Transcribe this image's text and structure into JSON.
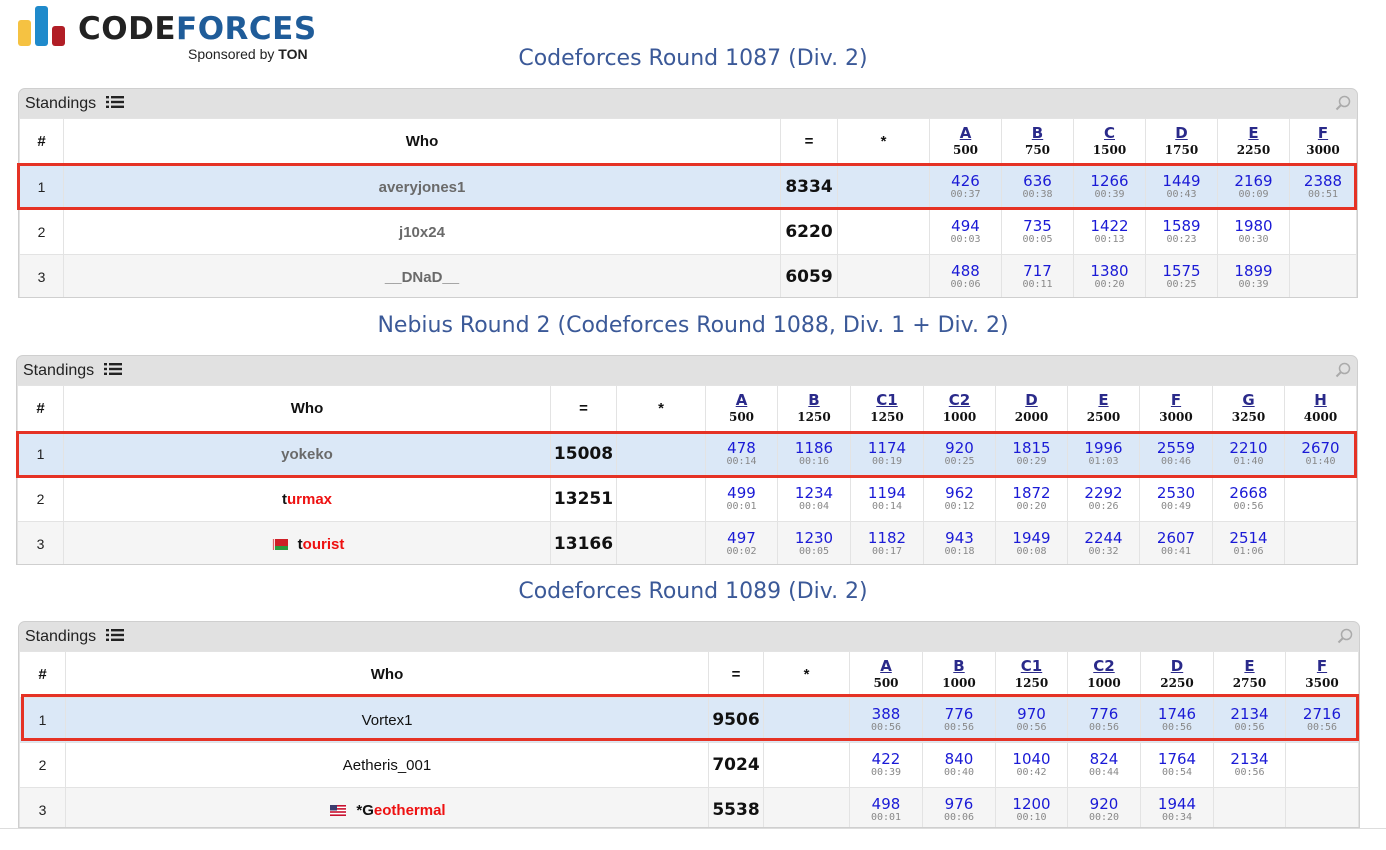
{
  "logo": {
    "text_1": "CODE",
    "text_2": "FORCES",
    "sponsor": "Sponsored by ",
    "sponsor_brand": "TON"
  },
  "colors": {
    "highlight_border": "#e53225",
    "highlight_row": "#dbe8f7",
    "title": "#3b5998",
    "result": "#1a1ad6",
    "red_handle": "#ee1111"
  },
  "icons": {
    "list": "list-icon",
    "search": "search-icon"
  },
  "contests": [
    {
      "title": "Codeforces Round 1087 (Div. 2)",
      "box_label": "Standings",
      "headers": {
        "rank": "#",
        "who": "Who",
        "points": "=",
        "penalty": "*"
      },
      "problems": [
        {
          "letter": "A",
          "points": "500"
        },
        {
          "letter": "B",
          "points": "750"
        },
        {
          "letter": "C",
          "points": "1500"
        },
        {
          "letter": "D",
          "points": "1750"
        },
        {
          "letter": "E",
          "points": "2250"
        },
        {
          "letter": "F",
          "points": "3000"
        }
      ],
      "rows": [
        {
          "rank": "1",
          "handle": "averyjones1",
          "points": "8334",
          "penalty": "",
          "results": [
            {
              "p": "426",
              "t": "00:37"
            },
            {
              "p": "636",
              "t": "00:38"
            },
            {
              "p": "1266",
              "t": "00:39"
            },
            {
              "p": "1449",
              "t": "00:43"
            },
            {
              "p": "2169",
              "t": "00:09"
            },
            {
              "p": "2388",
              "t": "00:51"
            }
          ]
        },
        {
          "rank": "2",
          "handle": "j10x24",
          "points": "6220",
          "penalty": "",
          "results": [
            {
              "p": "494",
              "t": "00:03"
            },
            {
              "p": "735",
              "t": "00:05"
            },
            {
              "p": "1422",
              "t": "00:13"
            },
            {
              "p": "1589",
              "t": "00:23"
            },
            {
              "p": "1980",
              "t": "00:30"
            },
            {
              "p": "",
              "t": ""
            }
          ]
        },
        {
          "rank": "3",
          "handle": "__DNaD__",
          "points": "6059",
          "penalty": "",
          "results": [
            {
              "p": "488",
              "t": "00:06"
            },
            {
              "p": "717",
              "t": "00:11"
            },
            {
              "p": "1380",
              "t": "00:20"
            },
            {
              "p": "1575",
              "t": "00:25"
            },
            {
              "p": "1899",
              "t": "00:39"
            },
            {
              "p": "",
              "t": ""
            }
          ]
        }
      ]
    },
    {
      "title": "Nebius Round 2 (Codeforces Round 1088, Div. 1 + Div. 2)",
      "box_label": "Standings",
      "headers": {
        "rank": "#",
        "who": "Who",
        "points": "=",
        "penalty": "*"
      },
      "problems": [
        {
          "letter": "A",
          "points": "500"
        },
        {
          "letter": "B",
          "points": "1250"
        },
        {
          "letter": "C1",
          "points": "1250"
        },
        {
          "letter": "C2",
          "points": "1000"
        },
        {
          "letter": "D",
          "points": "2000"
        },
        {
          "letter": "E",
          "points": "2500"
        },
        {
          "letter": "F",
          "points": "3000"
        },
        {
          "letter": "G",
          "points": "3250"
        },
        {
          "letter": "H",
          "points": "4000"
        }
      ],
      "rows": [
        {
          "rank": "1",
          "handle": "yokeko",
          "points": "15008",
          "penalty": "",
          "results": [
            {
              "p": "478",
              "t": "00:14"
            },
            {
              "p": "1186",
              "t": "00:16"
            },
            {
              "p": "1174",
              "t": "00:19"
            },
            {
              "p": "920",
              "t": "00:25"
            },
            {
              "p": "1815",
              "t": "00:29"
            },
            {
              "p": "1996",
              "t": "01:03"
            },
            {
              "p": "2559",
              "t": "00:46"
            },
            {
              "p": "2210",
              "t": "01:40"
            },
            {
              "p": "2670",
              "t": "01:40"
            }
          ]
        },
        {
          "rank": "2",
          "handle_first": "t",
          "handle_rest": "urmax",
          "points": "13251",
          "penalty": "",
          "results": [
            {
              "p": "499",
              "t": "00:01"
            },
            {
              "p": "1234",
              "t": "00:04"
            },
            {
              "p": "1194",
              "t": "00:14"
            },
            {
              "p": "962",
              "t": "00:12"
            },
            {
              "p": "1872",
              "t": "00:20"
            },
            {
              "p": "2292",
              "t": "00:26"
            },
            {
              "p": "2530",
              "t": "00:49"
            },
            {
              "p": "2668",
              "t": "00:56"
            },
            {
              "p": "",
              "t": ""
            }
          ]
        },
        {
          "rank": "3",
          "handle_first": "t",
          "handle_rest": "ourist",
          "points": "13166",
          "penalty": "",
          "results": [
            {
              "p": "497",
              "t": "00:02"
            },
            {
              "p": "1230",
              "t": "00:05"
            },
            {
              "p": "1182",
              "t": "00:17"
            },
            {
              "p": "943",
              "t": "00:18"
            },
            {
              "p": "1949",
              "t": "00:08"
            },
            {
              "p": "2244",
              "t": "00:32"
            },
            {
              "p": "2607",
              "t": "00:41"
            },
            {
              "p": "2514",
              "t": "01:06"
            },
            {
              "p": "",
              "t": ""
            }
          ]
        }
      ]
    },
    {
      "title": "Codeforces Round 1089 (Div. 2)",
      "box_label": "Standings",
      "headers": {
        "rank": "#",
        "who": "Who",
        "points": "=",
        "penalty": "*"
      },
      "problems": [
        {
          "letter": "A",
          "points": "500"
        },
        {
          "letter": "B",
          "points": "1000"
        },
        {
          "letter": "C1",
          "points": "1250"
        },
        {
          "letter": "C2",
          "points": "1000"
        },
        {
          "letter": "D",
          "points": "2250"
        },
        {
          "letter": "E",
          "points": "2750"
        },
        {
          "letter": "F",
          "points": "3500"
        }
      ],
      "rows": [
        {
          "rank": "1",
          "handle": "Vortex1",
          "points": "9506",
          "penalty": "",
          "results": [
            {
              "p": "388",
              "t": "00:56"
            },
            {
              "p": "776",
              "t": "00:56"
            },
            {
              "p": "970",
              "t": "00:56"
            },
            {
              "p": "776",
              "t": "00:56"
            },
            {
              "p": "1746",
              "t": "00:56"
            },
            {
              "p": "2134",
              "t": "00:56"
            },
            {
              "p": "2716",
              "t": "00:56"
            }
          ]
        },
        {
          "rank": "2",
          "handle": "Aetheris_001",
          "points": "7024",
          "penalty": "",
          "results": [
            {
              "p": "422",
              "t": "00:39"
            },
            {
              "p": "840",
              "t": "00:40"
            },
            {
              "p": "1040",
              "t": "00:42"
            },
            {
              "p": "824",
              "t": "00:44"
            },
            {
              "p": "1764",
              "t": "00:54"
            },
            {
              "p": "2134",
              "t": "00:56"
            },
            {
              "p": "",
              "t": ""
            }
          ]
        },
        {
          "rank": "3",
          "handle_prefix": "*",
          "handle_first": "G",
          "handle_rest": "eothermal",
          "points": "5538",
          "penalty": "",
          "results": [
            {
              "p": "498",
              "t": "00:01"
            },
            {
              "p": "976",
              "t": "00:06"
            },
            {
              "p": "1200",
              "t": "00:10"
            },
            {
              "p": "920",
              "t": "00:20"
            },
            {
              "p": "1944",
              "t": "00:34"
            },
            {
              "p": "",
              "t": ""
            },
            {
              "p": "",
              "t": ""
            }
          ]
        }
      ]
    }
  ]
}
